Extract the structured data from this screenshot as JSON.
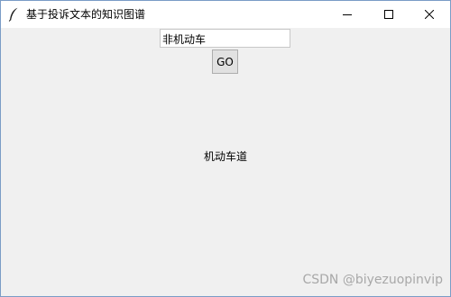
{
  "window": {
    "title": "基于投诉文本的知识图谱"
  },
  "form": {
    "query_value": "非机动车",
    "go_label": "GO"
  },
  "result": {
    "text": "机动车道"
  },
  "watermark": {
    "text": "CSDN @biyezuopinvip"
  }
}
